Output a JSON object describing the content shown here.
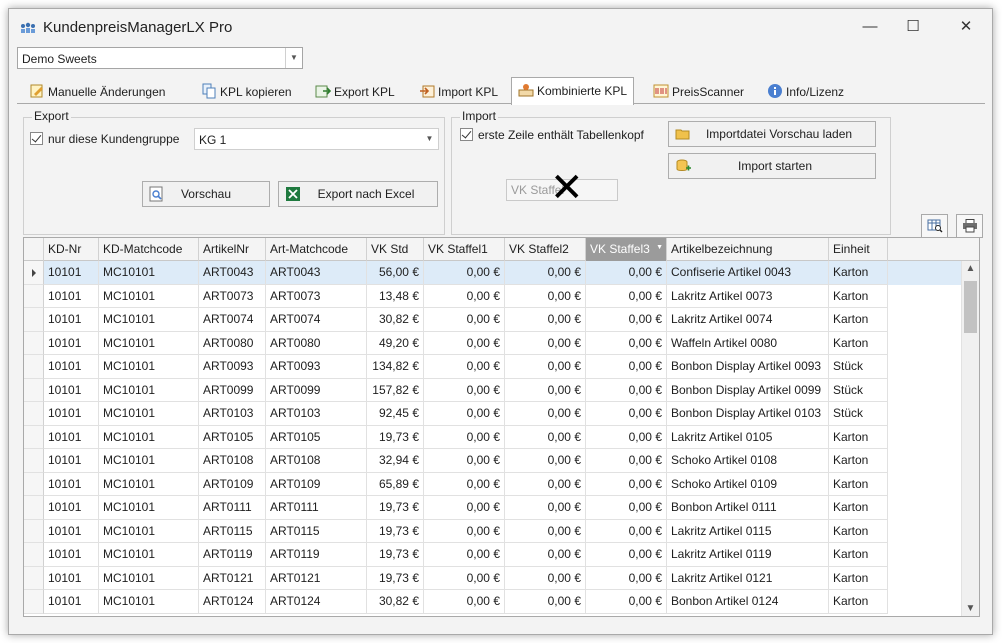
{
  "window": {
    "title": "KundenpreisManagerLX Pro"
  },
  "customer": {
    "selected": "Demo Sweets"
  },
  "tabs": [
    {
      "label": "Manuelle Änderungen",
      "icon": "edit-sheet-icon"
    },
    {
      "label": "KPL kopieren",
      "icon": "copy-icon"
    },
    {
      "label": "Export KPL",
      "icon": "export-icon"
    },
    {
      "label": "Import KPL",
      "icon": "import-icon"
    },
    {
      "label": "Kombinierte KPL",
      "icon": "combined-icon"
    },
    {
      "label": "PreisScanner",
      "icon": "scanner-icon"
    },
    {
      "label": "Info/Lizenz",
      "icon": "info-icon"
    }
  ],
  "export": {
    "title": "Export",
    "only_group_label": "nur diese Kundengruppe",
    "group_value": "KG 1",
    "preview_label": "Vorschau",
    "excel_label": "Export nach Excel"
  },
  "import": {
    "title": "Import",
    "header_row_label": "erste Zeile enthält Tabellenkopf",
    "load_preview_label": "Importdatei Vorschau laden",
    "start_label": "Import starten",
    "field_value": "VK Staffel"
  },
  "grid": {
    "columns": [
      "KD-Nr",
      "KD-Matchcode",
      "ArtikelNr",
      "Art-Matchcode",
      "VK Std",
      "VK Staffel1",
      "VK Staffel2",
      "VK Staffel3",
      "Artikelbezeichnung",
      "Einheit"
    ],
    "rows": [
      [
        "10101",
        "MC10101",
        "ART0043",
        "ART0043",
        "56,00 €",
        "0,00 €",
        "0,00 €",
        "0,00 €",
        "Confiserie Artikel 0043",
        "Karton"
      ],
      [
        "10101",
        "MC10101",
        "ART0073",
        "ART0073",
        "13,48 €",
        "0,00 €",
        "0,00 €",
        "0,00 €",
        "Lakritz Artikel 0073",
        "Karton"
      ],
      [
        "10101",
        "MC10101",
        "ART0074",
        "ART0074",
        "30,82 €",
        "0,00 €",
        "0,00 €",
        "0,00 €",
        "Lakritz Artikel 0074",
        "Karton"
      ],
      [
        "10101",
        "MC10101",
        "ART0080",
        "ART0080",
        "49,20 €",
        "0,00 €",
        "0,00 €",
        "0,00 €",
        "Waffeln Artikel 0080",
        "Karton"
      ],
      [
        "10101",
        "MC10101",
        "ART0093",
        "ART0093",
        "134,82 €",
        "0,00 €",
        "0,00 €",
        "0,00 €",
        "Bonbon Display  Artikel 0093",
        "Stück"
      ],
      [
        "10101",
        "MC10101",
        "ART0099",
        "ART0099",
        "157,82 €",
        "0,00 €",
        "0,00 €",
        "0,00 €",
        "Bonbon Display  Artikel 0099",
        "Stück"
      ],
      [
        "10101",
        "MC10101",
        "ART0103",
        "ART0103",
        "92,45 €",
        "0,00 €",
        "0,00 €",
        "0,00 €",
        "Bonbon Display  Artikel 0103",
        "Stück"
      ],
      [
        "10101",
        "MC10101",
        "ART0105",
        "ART0105",
        "19,73 €",
        "0,00 €",
        "0,00 €",
        "0,00 €",
        "Lakritz Artikel 0105",
        "Karton"
      ],
      [
        "10101",
        "MC10101",
        "ART0108",
        "ART0108",
        "32,94 €",
        "0,00 €",
        "0,00 €",
        "0,00 €",
        "Schoko Artikel 0108",
        "Karton"
      ],
      [
        "10101",
        "MC10101",
        "ART0109",
        "ART0109",
        "65,89 €",
        "0,00 €",
        "0,00 €",
        "0,00 €",
        "Schoko Artikel 0109",
        "Karton"
      ],
      [
        "10101",
        "MC10101",
        "ART0111",
        "ART0111",
        "19,73 €",
        "0,00 €",
        "0,00 €",
        "0,00 €",
        "Bonbon Artikel 0111",
        "Karton"
      ],
      [
        "10101",
        "MC10101",
        "ART0115",
        "ART0115",
        "19,73 €",
        "0,00 €",
        "0,00 €",
        "0,00 €",
        "Lakritz Artikel 0115",
        "Karton"
      ],
      [
        "10101",
        "MC10101",
        "ART0119",
        "ART0119",
        "19,73 €",
        "0,00 €",
        "0,00 €",
        "0,00 €",
        "Lakritz Artikel 0119",
        "Karton"
      ],
      [
        "10101",
        "MC10101",
        "ART0121",
        "ART0121",
        "19,73 €",
        "0,00 €",
        "0,00 €",
        "0,00 €",
        "Lakritz Artikel 0121",
        "Karton"
      ],
      [
        "10101",
        "MC10101",
        "ART0124",
        "ART0124",
        "30,82 €",
        "0,00 €",
        "0,00 €",
        "0,00 €",
        "Bonbon Artikel 0124",
        "Karton"
      ]
    ]
  }
}
